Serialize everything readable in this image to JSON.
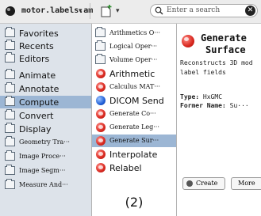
{
  "toolbar": {
    "file_title": "motor.labels.am",
    "search_placeholder": "Enter a search",
    "clear_glyph": "✕"
  },
  "categories": [
    {
      "label": "Favorites",
      "icon": "star-folder-icon"
    },
    {
      "label": "Recents",
      "icon": "clock-folder-icon"
    },
    {
      "label": "Editors",
      "icon": "editor-folder-icon"
    },
    {
      "label": "Animate",
      "icon": "folder-icon"
    },
    {
      "label": "Annotate",
      "icon": "folder-icon"
    },
    {
      "label": "Compute",
      "icon": "folder-icon",
      "selected": true
    },
    {
      "label": "Convert",
      "icon": "folder-icon"
    },
    {
      "label": "Display",
      "icon": "folder-icon"
    },
    {
      "label": "Geometry Tra···",
      "icon": "folder-icon"
    },
    {
      "label": "Image Proce···",
      "icon": "folder-icon"
    },
    {
      "label": "Image Segm···",
      "icon": "folder-icon"
    },
    {
      "label": "Measure And···",
      "icon": "folder-icon"
    }
  ],
  "modules": [
    {
      "label": "Arithmetics O···",
      "icon": "folder-icon"
    },
    {
      "label": "Logical Oper···",
      "icon": "folder-icon"
    },
    {
      "label": "Volume Oper···",
      "icon": "folder-icon"
    },
    {
      "label": "Arithmetic",
      "icon": "module-icon"
    },
    {
      "label": "Calculus MAT···",
      "icon": "module-icon"
    },
    {
      "label": "DICOM Send",
      "icon": "dicom-icon"
    },
    {
      "label": "Generate Co···",
      "icon": "module-icon"
    },
    {
      "label": "Generate Leg···",
      "icon": "module-icon"
    },
    {
      "label": "Generate Sur···",
      "icon": "module-icon",
      "selected": true
    },
    {
      "label": "Interpolate",
      "icon": "module-icon"
    },
    {
      "label": "Relabel",
      "icon": "module-icon"
    }
  ],
  "footer_label": "(2)",
  "detail": {
    "title_line1": "Generate",
    "title_line2": "Surface",
    "desc_line1": "Reconstructs 3D mod",
    "desc_line2": "label fields",
    "type_key": "Type:",
    "type_value": "HxGMC",
    "former_key": "Former Name:",
    "former_value": "Su···",
    "create_label": "Create",
    "more_label": "More"
  }
}
